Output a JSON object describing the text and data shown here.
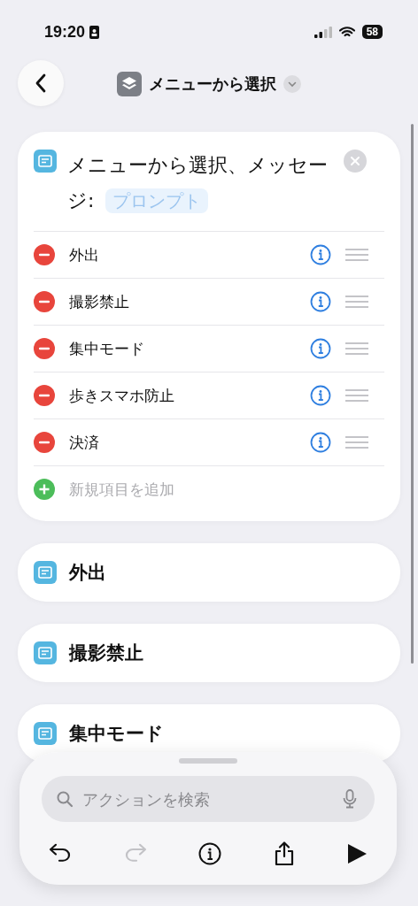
{
  "status_bar": {
    "time": "19:20",
    "battery": "58"
  },
  "nav": {
    "title": "メニューから選択"
  },
  "menu_card": {
    "title": "メニューから選択、メッセージ:",
    "prompt": "プロンプト",
    "items": [
      {
        "label": "外出"
      },
      {
        "label": "撮影禁止"
      },
      {
        "label": "集中モード"
      },
      {
        "label": "歩きスマホ防止"
      },
      {
        "label": "決済"
      }
    ],
    "add_label": "新規項目を追加"
  },
  "cases": [
    {
      "label": "外出"
    },
    {
      "label": "撮影禁止"
    },
    {
      "label": "集中モード"
    }
  ],
  "toolbar": {
    "search_placeholder": "アクションを検索",
    "buttons": [
      {
        "kind": "undo",
        "disabled": false
      },
      {
        "kind": "redo",
        "disabled": true
      },
      {
        "kind": "info",
        "disabled": false
      },
      {
        "kind": "share",
        "disabled": false
      },
      {
        "kind": "run",
        "disabled": false
      }
    ]
  }
}
